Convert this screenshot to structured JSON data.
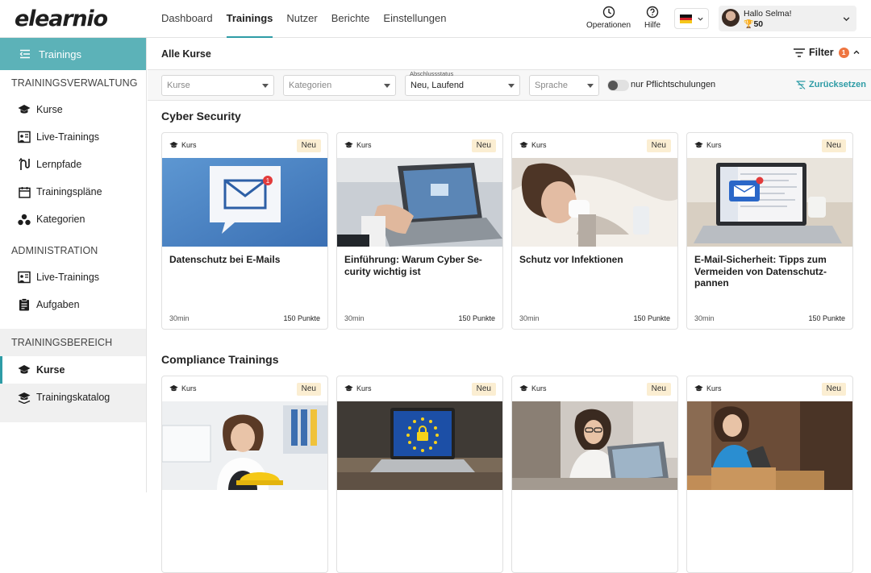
{
  "app": {
    "logo_text": "elearnio"
  },
  "nav": {
    "items": [
      {
        "label": "Dashboard",
        "active": false
      },
      {
        "label": "Trainings",
        "active": true
      },
      {
        "label": "Nutzer",
        "active": false
      },
      {
        "label": "Berichte",
        "active": false
      },
      {
        "label": "Einstellungen",
        "active": false
      }
    ]
  },
  "header_tools": {
    "operations_label": "Operationen",
    "help_label": "Hilfe",
    "language": "de",
    "user_greeting": "Hallo Selma!",
    "user_points": "50"
  },
  "sidebar": {
    "top_label": "Trainings",
    "sections": [
      {
        "title": "TRAININGSVERWALTUNG",
        "items": [
          {
            "label": "Kurse",
            "icon": "graduation-cap-icon"
          },
          {
            "label": "Live-Trainings",
            "icon": "presentation-icon"
          },
          {
            "label": "Lernpfade",
            "icon": "path-icon"
          },
          {
            "label": "Trainingspläne",
            "icon": "calendar-icon"
          },
          {
            "label": "Kategorien",
            "icon": "categories-icon"
          }
        ]
      },
      {
        "title": "ADMINISTRATION",
        "items": [
          {
            "label": "Live-Trainings",
            "icon": "presentation-icon"
          },
          {
            "label": "Aufgaben",
            "icon": "clipboard-icon"
          }
        ]
      },
      {
        "title": "TRAININGSBEREICH",
        "items": [
          {
            "label": "Kurse",
            "icon": "graduation-cap-icon",
            "active": true
          },
          {
            "label": "Trainingskatalog",
            "icon": "catalog-icon"
          }
        ]
      }
    ]
  },
  "subbar": {
    "title": "Alle Kurse",
    "filter_label": "Filter",
    "filter_count": "1"
  },
  "filters": {
    "kurse_placeholder": "Kurse",
    "kategorien_placeholder": "Kategorien",
    "status_label": "Abschlussstatus",
    "status_value": "Neu, Laufend",
    "sprache_placeholder": "Sprache",
    "toggle_label": "nur Pflichtschulungen",
    "reset_label": "Zurücksetzen"
  },
  "sections": [
    {
      "title": "Cyber Security",
      "cards": [
        {
          "type": "Kurs",
          "badge": "Neu",
          "title": "Datenschutz bei E-Mails",
          "duration": "30min",
          "points": "150 Punkte",
          "image": "email-icon-illustration"
        },
        {
          "type": "Kurs",
          "badge": "Neu",
          "title": "Einführung: Warum Cyber Se-curity wichtig ist",
          "duration": "30min",
          "points": "150 Punkte",
          "image": "laptop-typing"
        },
        {
          "type": "Kurs",
          "badge": "Neu",
          "title": "Schutz vor Infektionen",
          "duration": "30min",
          "points": "150 Punkte",
          "image": "sick-woman"
        },
        {
          "type": "Kurs",
          "badge": "Neu",
          "title": "E-Mail-Sicherheit: Tipps zum Vermeiden von Datenschutz-pannen",
          "duration": "30min",
          "points": "150 Punkte",
          "image": "laptop-email-desk"
        }
      ]
    },
    {
      "title": "Compliance Trainings",
      "cards": [
        {
          "type": "Kurs",
          "badge": "Neu",
          "image": "woman-hardhat-office"
        },
        {
          "type": "Kurs",
          "badge": "Neu",
          "image": "laptop-eu-lock"
        },
        {
          "type": "Kurs",
          "badge": "Neu",
          "image": "woman-laptop-office"
        },
        {
          "type": "Kurs",
          "badge": "Neu",
          "image": "woman-warehouse-tablet"
        }
      ]
    }
  ],
  "colors": {
    "accent": "#2e9ca6",
    "sidebar_top": "#5cb2b8",
    "badge_bg": "#fbeed2",
    "filter_badge": "#ee7540"
  }
}
